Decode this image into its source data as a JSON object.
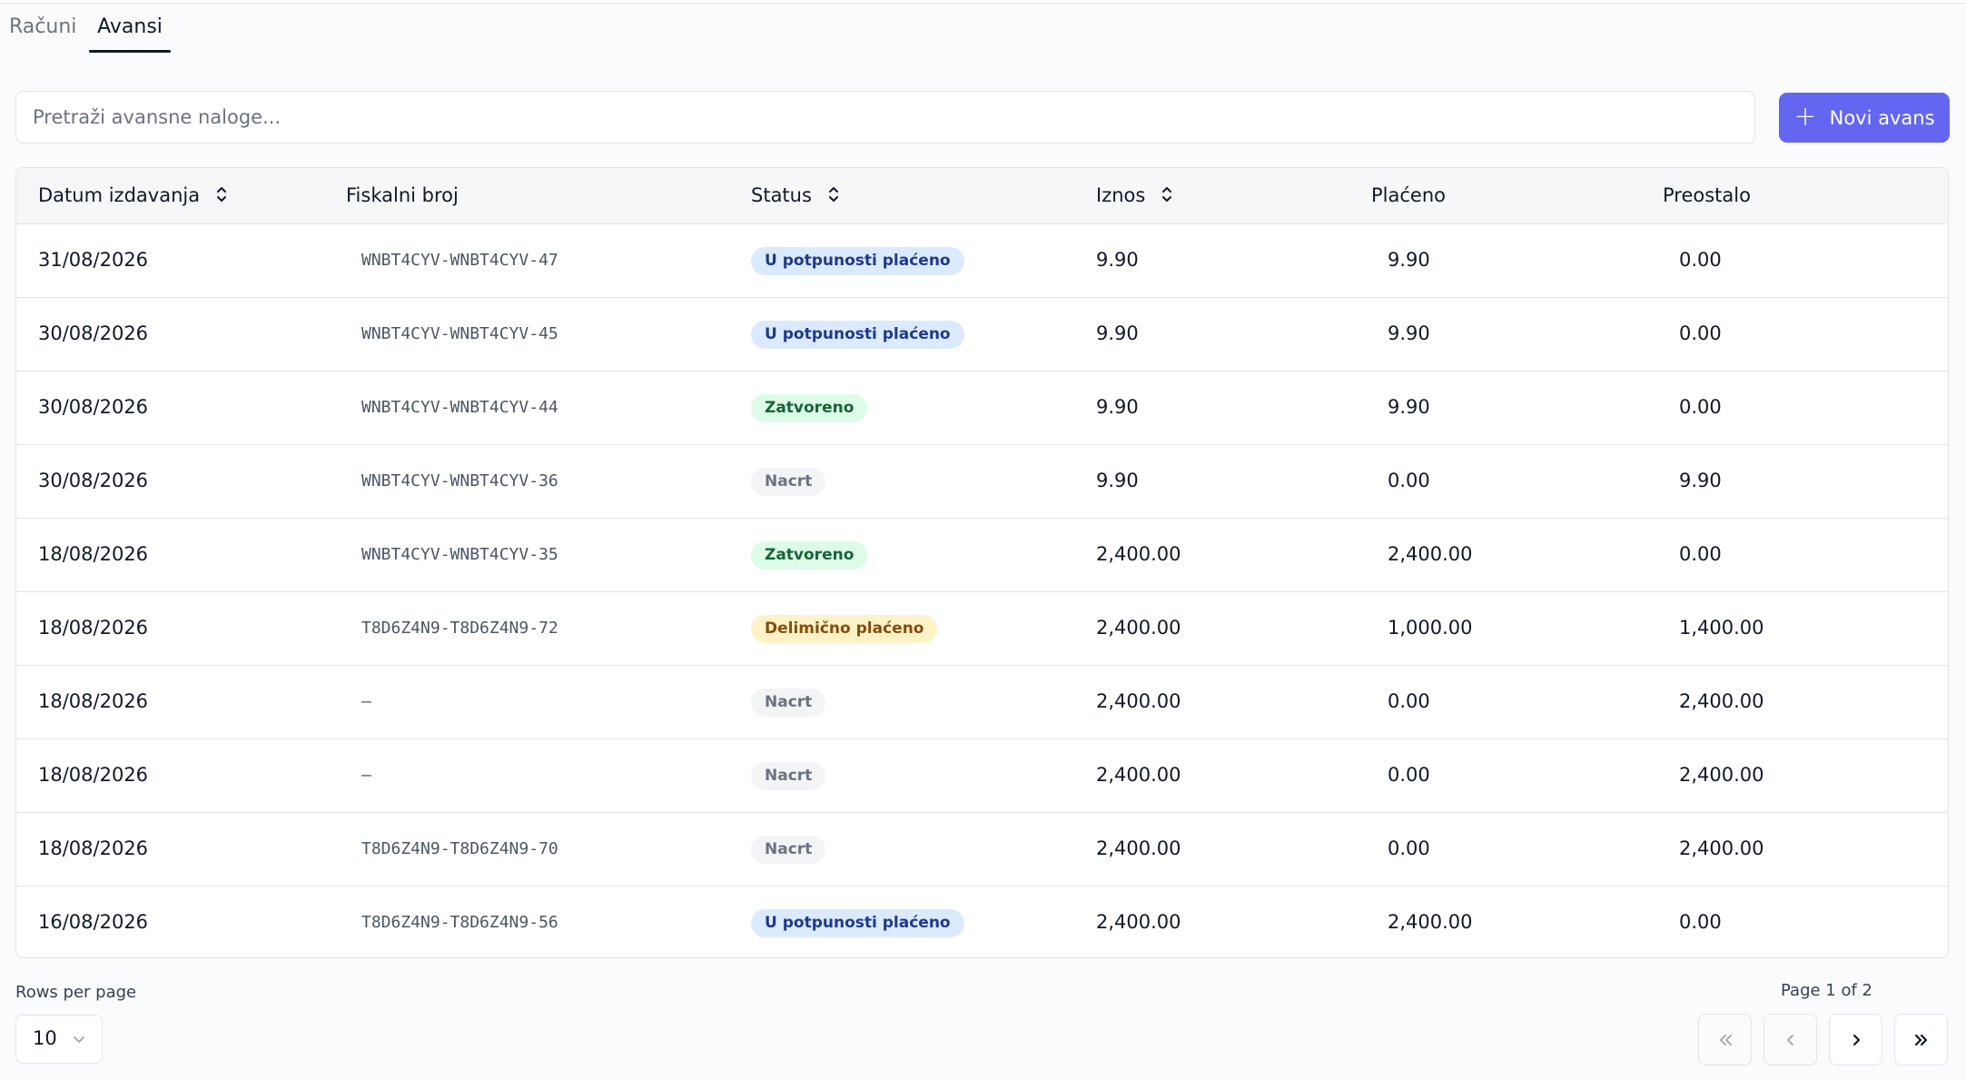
{
  "tabs": [
    {
      "label": "Računi",
      "active": false
    },
    {
      "label": "Avansi",
      "active": true
    }
  ],
  "search": {
    "placeholder": "Pretraži avansne naloge...",
    "value": ""
  },
  "new_button": {
    "label": "Novi avans",
    "icon": "plus-icon"
  },
  "colors": {
    "accent": "#6366f1",
    "badge_paid": "#dbeafe",
    "badge_closed": "#dcfce7",
    "badge_draft": "#f3f4f6",
    "badge_partial": "#fef3c7"
  },
  "table": {
    "columns": [
      {
        "label": "Datum izdavanja",
        "sortable": true
      },
      {
        "label": "Fiskalni broj",
        "sortable": false
      },
      {
        "label": "Status",
        "sortable": true
      },
      {
        "label": "Iznos",
        "sortable": true
      },
      {
        "label": "Plaćeno",
        "sortable": false
      },
      {
        "label": "Preostalo",
        "sortable": false
      }
    ],
    "rows": [
      {
        "date": "31/08/2026",
        "fiscal": "WNBT4CYV-WNBT4CYV-47",
        "status": "U potpunosti plaćeno",
        "status_kind": "paid",
        "amount": "9.90",
        "paid": "9.90",
        "remaining": "0.00"
      },
      {
        "date": "30/08/2026",
        "fiscal": "WNBT4CYV-WNBT4CYV-45",
        "status": "U potpunosti plaćeno",
        "status_kind": "paid",
        "amount": "9.90",
        "paid": "9.90",
        "remaining": "0.00"
      },
      {
        "date": "30/08/2026",
        "fiscal": "WNBT4CYV-WNBT4CYV-44",
        "status": "Zatvoreno",
        "status_kind": "closed",
        "amount": "9.90",
        "paid": "9.90",
        "remaining": "0.00"
      },
      {
        "date": "30/08/2026",
        "fiscal": "WNBT4CYV-WNBT4CYV-36",
        "status": "Nacrt",
        "status_kind": "draft",
        "amount": "9.90",
        "paid": "0.00",
        "remaining": "9.90"
      },
      {
        "date": "18/08/2026",
        "fiscal": "WNBT4CYV-WNBT4CYV-35",
        "status": "Zatvoreno",
        "status_kind": "closed",
        "amount": "2,400.00",
        "paid": "2,400.00",
        "remaining": "0.00"
      },
      {
        "date": "18/08/2026",
        "fiscal": "T8D6Z4N9-T8D6Z4N9-72",
        "status": "Delimično plaćeno",
        "status_kind": "partial",
        "amount": "2,400.00",
        "paid": "1,000.00",
        "remaining": "1,400.00"
      },
      {
        "date": "18/08/2026",
        "fiscal": "—",
        "status": "Nacrt",
        "status_kind": "draft",
        "amount": "2,400.00",
        "paid": "0.00",
        "remaining": "2,400.00"
      },
      {
        "date": "18/08/2026",
        "fiscal": "—",
        "status": "Nacrt",
        "status_kind": "draft",
        "amount": "2,400.00",
        "paid": "0.00",
        "remaining": "2,400.00"
      },
      {
        "date": "18/08/2026",
        "fiscal": "T8D6Z4N9-T8D6Z4N9-70",
        "status": "Nacrt",
        "status_kind": "draft",
        "amount": "2,400.00",
        "paid": "0.00",
        "remaining": "2,400.00"
      },
      {
        "date": "16/08/2026",
        "fiscal": "T8D6Z4N9-T8D6Z4N9-56",
        "status": "U potpunosti plaćeno",
        "status_kind": "paid",
        "amount": "2,400.00",
        "paid": "2,400.00",
        "remaining": "0.00"
      }
    ]
  },
  "pagination": {
    "rows_per_page_label": "Rows per page",
    "rows_per_page": "10",
    "page_info": "Page 1 of 2",
    "buttons": [
      {
        "name": "first-page-button",
        "icon": "chevrons-left-icon",
        "disabled": true
      },
      {
        "name": "previous-page-button",
        "icon": "chevron-left-icon",
        "disabled": true
      },
      {
        "name": "next-page-button",
        "icon": "chevron-right-icon",
        "disabled": false
      },
      {
        "name": "last-page-button",
        "icon": "chevrons-right-icon",
        "disabled": false
      }
    ]
  }
}
